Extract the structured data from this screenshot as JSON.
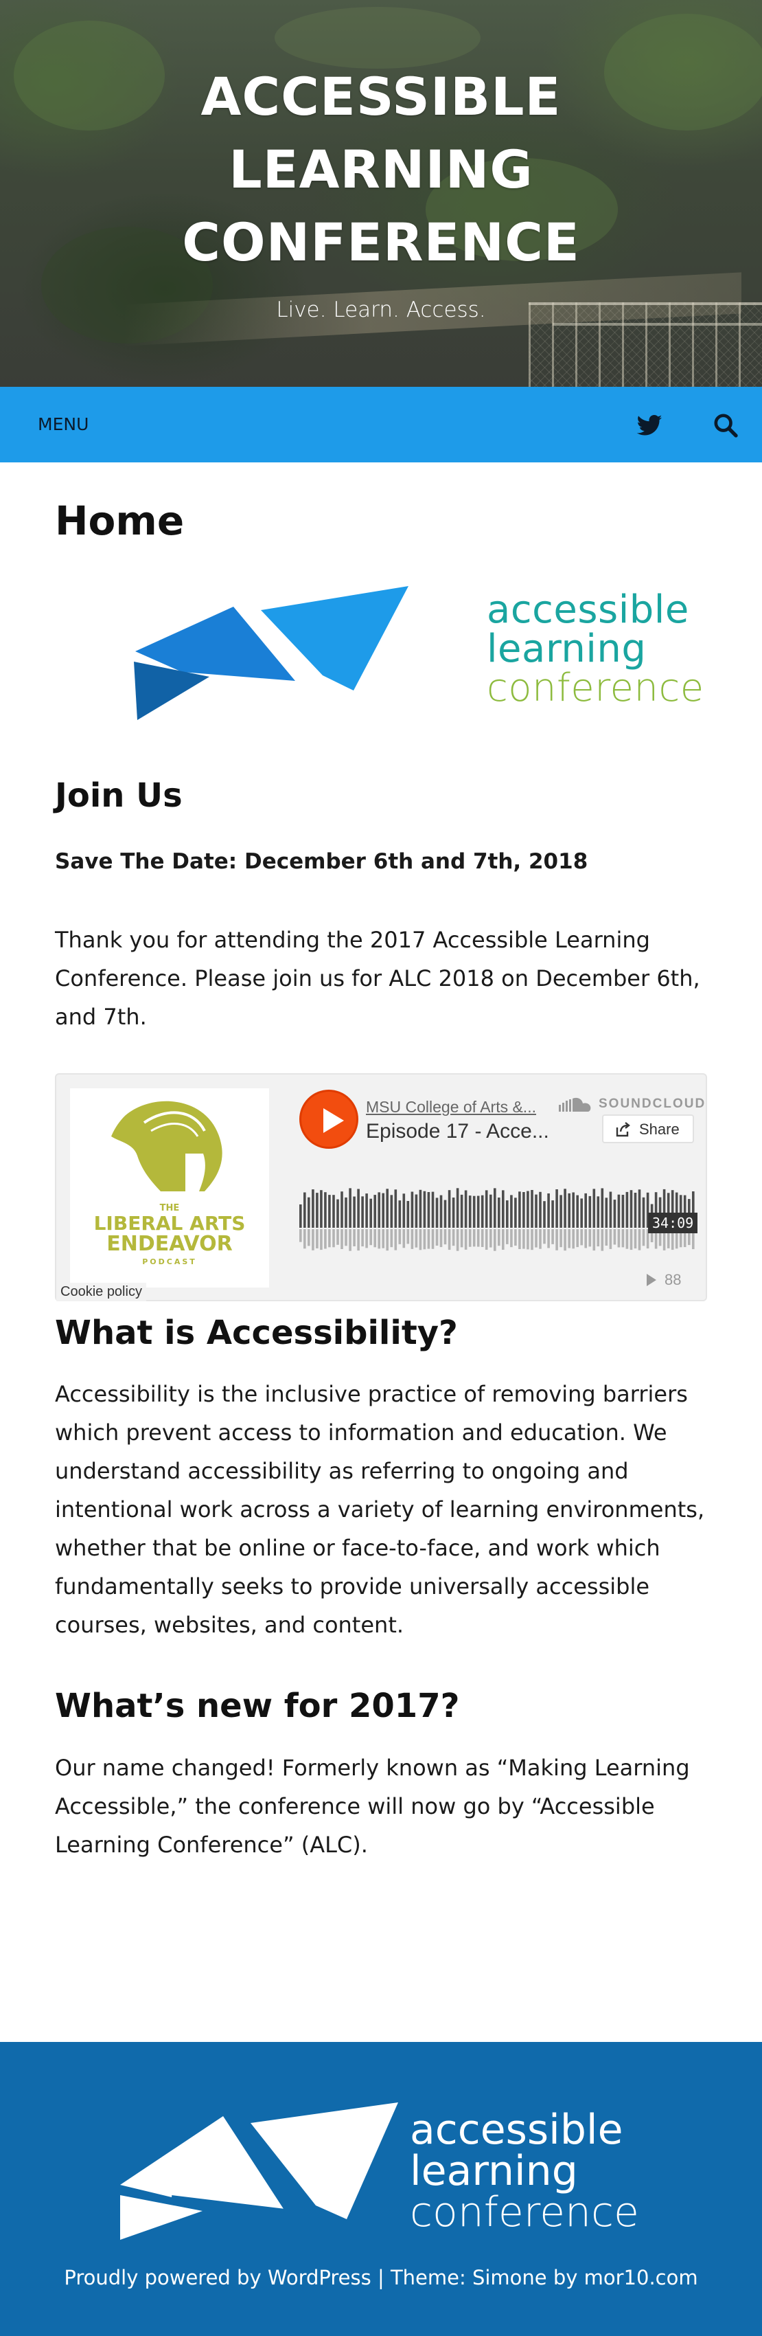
{
  "site": {
    "title": "ACCESSIBLE LEARNING CONFERENCE",
    "title_lines": [
      "ACCESSIBLE",
      "LEARNING",
      "CONFERENCE"
    ],
    "tagline": "Live. Learn. Access."
  },
  "nav": {
    "menu_label": "MENU",
    "icons": [
      "twitter-icon",
      "search-icon"
    ],
    "bar_color": "#1e9be9"
  },
  "page": {
    "title": "Home",
    "logo": {
      "line1": "accessible",
      "line2": "learning",
      "line3": "conference",
      "colors": {
        "teal": "#1aa5a0",
        "green": "#8dbb3e",
        "blue_light": "#1e9be9",
        "blue_mid": "#1a7fd6",
        "blue_dark": "#1162a6"
      }
    },
    "join": {
      "heading": "Join Us",
      "save_date": "Save The Date: December 6th and 7th, 2018",
      "body": "Thank you for attending the 2017 Accessible Learning Conference. Please join us for ALC 2018 on December 6th, and 7th."
    },
    "player": {
      "user": "MSU College of Arts &...",
      "track": "Episode 17 - Acce...",
      "brand": "SOUNDCLOUD",
      "share_label": "Share",
      "duration": "34:09",
      "plays": "88",
      "cookie_policy": "Cookie policy",
      "artwork": {
        "line1": "THE",
        "line2": "LIBERAL ARTS",
        "line3": "ENDEAVOR",
        "line4": "PODCAST",
        "color": "#b4b83b"
      },
      "accent": "#f24d0f"
    },
    "accessibility": {
      "heading": "What is Accessibility?",
      "body": "Accessibility is the inclusive practice of removing barriers which prevent access to information and education. We understand accessibility as referring to ongoing and intentional work across a variety of learning environments, whether that be online or face-to-face, and work which fundamentally seeks to provide universally accessible courses, websites, and content."
    },
    "whats_new": {
      "heading": "What’s new for 2017?",
      "body": "Our name changed! Formerly known as “Making Learning Accessible,” the conference will now go by “Accessible Learning Conference” (ALC)."
    }
  },
  "footer": {
    "logo": {
      "line1": "accessible",
      "line2": "learning",
      "line3": "conference"
    },
    "credits": {
      "powered": "Proudly powered by WordPress",
      "separator": "|",
      "theme": "Theme: Simone by mor10.com"
    },
    "bg_color": "#106aab"
  }
}
